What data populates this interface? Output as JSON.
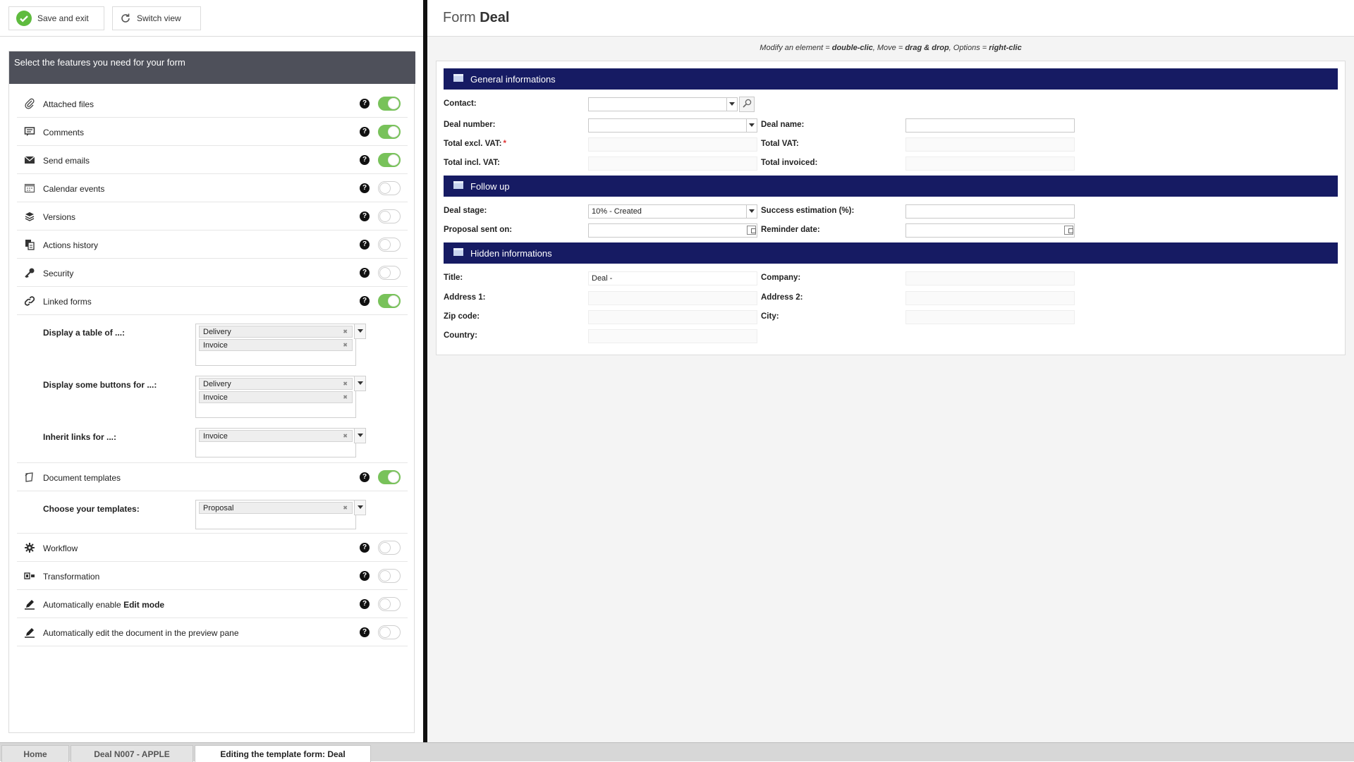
{
  "toolbar": {
    "save_label": "Save and exit",
    "switch_label": "Switch view"
  },
  "features": {
    "header": "Select the features you need for your form",
    "items": [
      {
        "label": "Attached files",
        "icon": "paperclip-icon",
        "on": true
      },
      {
        "label": "Comments",
        "icon": "comment-icon",
        "on": true
      },
      {
        "label": "Send emails",
        "icon": "envelope-icon",
        "on": true
      },
      {
        "label": "Calendar events",
        "icon": "calendar-icon",
        "on": false
      },
      {
        "label": "Versions",
        "icon": "layers-icon",
        "on": false
      },
      {
        "label": "Actions history",
        "icon": "history-icon",
        "on": false
      },
      {
        "label": "Security",
        "icon": "key-icon",
        "on": false
      },
      {
        "label": "Linked forms",
        "icon": "link-icon",
        "on": true
      },
      {
        "label": "Document templates",
        "icon": "document-template-icon",
        "on": true
      },
      {
        "label": "Workflow",
        "icon": "gear-icon",
        "on": false
      },
      {
        "label": "Transformation",
        "icon": "transformation-icon",
        "on": false
      },
      {
        "label_prefix": "Automatically enable ",
        "label_bold": "Edit mode",
        "icon": "pencil-icon",
        "on": false
      },
      {
        "label": "Automatically edit the document in the preview pane",
        "icon": "pencil-icon",
        "on": false
      }
    ],
    "linked": {
      "table_label": "Display a table of ...:",
      "table_items": [
        "Delivery",
        "Invoice"
      ],
      "buttons_label": "Display some buttons for ...:",
      "buttons_items": [
        "Delivery",
        "Invoice"
      ],
      "inherit_label": "Inherit links for ...:",
      "inherit_items": [
        "Invoice"
      ]
    },
    "templates": {
      "label": "Choose your templates:",
      "items": [
        "Proposal"
      ]
    }
  },
  "form": {
    "title_prefix": "Form",
    "title_name": "Deal",
    "hint": {
      "p1": "Modify an element = ",
      "b1": "double-clic",
      "p2": ", Move = ",
      "b2": "drag & drop",
      "p3": ", Options = ",
      "b3": "right-clic"
    },
    "sections": {
      "general": "General informations",
      "follow": "Follow up",
      "hidden": "Hidden informations"
    },
    "labels": {
      "contact": "Contact:",
      "deal_number": "Deal number:",
      "deal_name": "Deal name:",
      "total_excl": "Total excl. VAT:",
      "required_mark": "*",
      "total_vat": "Total VAT:",
      "total_incl": "Total incl. VAT:",
      "total_invoiced": "Total invoiced:",
      "deal_stage": "Deal stage:",
      "success_estimation": "Success estimation (%):",
      "proposal_sent": "Proposal sent on:",
      "reminder_date": "Reminder date:",
      "title": "Title:",
      "company": "Company:",
      "address1": "Address 1:",
      "address2": "Address 2:",
      "zip": "Zip code:",
      "city": "City:",
      "country": "Country:"
    },
    "values": {
      "deal_stage": "10% - Created",
      "title": "Deal  -"
    }
  },
  "tabs": [
    {
      "label": "Home",
      "active": false
    },
    {
      "label": "Deal N007 - APPLE",
      "active": false
    },
    {
      "label": "Editing the template form: Deal",
      "active": true
    }
  ]
}
